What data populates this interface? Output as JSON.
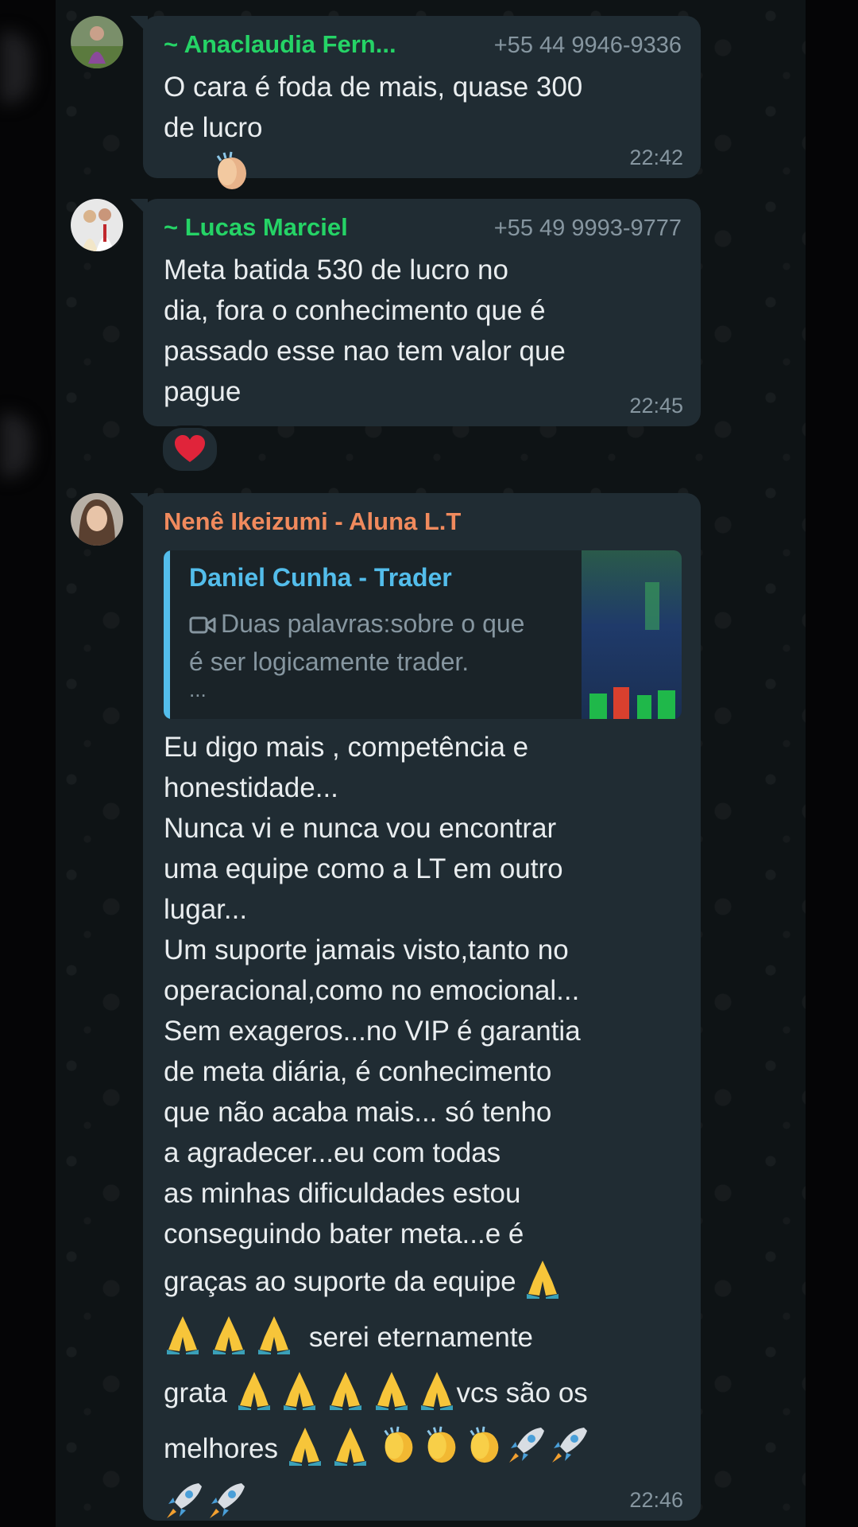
{
  "messages": [
    {
      "sender": "~ Anaclaudia Fern...",
      "phone": "+55 44 9946-9336",
      "sender_color": "#25d366",
      "text_line1": "O cara é foda de mais, quase 300",
      "text_line2": "de lucro",
      "time": "22:42"
    },
    {
      "sender": "~ Lucas Marciel",
      "phone": "+55 49 9993-9777",
      "sender_color": "#25d366",
      "text": "Meta batida 530 de lucro no\ndia, fora o conhecimento que é\npassado esse nao tem valor que\npague",
      "time": "22:45",
      "reaction": "heart"
    },
    {
      "sender": "Nenê Ikeizumi - Aluna L.T",
      "sender_color": "#f08a5d",
      "quote": {
        "author": "Daniel Cunha - Trader",
        "text_line1": "Duas palavras:sobre o que",
        "text_line2": "é ser logicamente trader.",
        "ellipsis": "...",
        "icon": "video-camera-icon"
      },
      "text": "Eu digo mais , competência e\nhonestidade...\nNunca vi e nunca vou encontrar\numa equipe como a LT em outro\nlugar...\nUm suporte jamais visto,tanto no\noperacional,como no emocional...\nSem exageros...no VIP é garantia\nde meta diária, é conhecimento\nque não acaba mais... só tenho\na agradecer...eu com todas\nas minhas dificuldades estou\nconseguindo bater meta...e é",
      "emoji_line1_text": "graças ao suporte da equipe",
      "emoji_line2_text": "serei eternamente",
      "emoji_line3_a": "grata",
      "emoji_line3_b": "vcs são os",
      "emoji_line4_text": "melhores",
      "time": "22:46"
    }
  ],
  "colors": {
    "bubble": "#202c33",
    "text": "#e9edef",
    "meta": "#8696a0",
    "quote_accent": "#53bdeb"
  }
}
